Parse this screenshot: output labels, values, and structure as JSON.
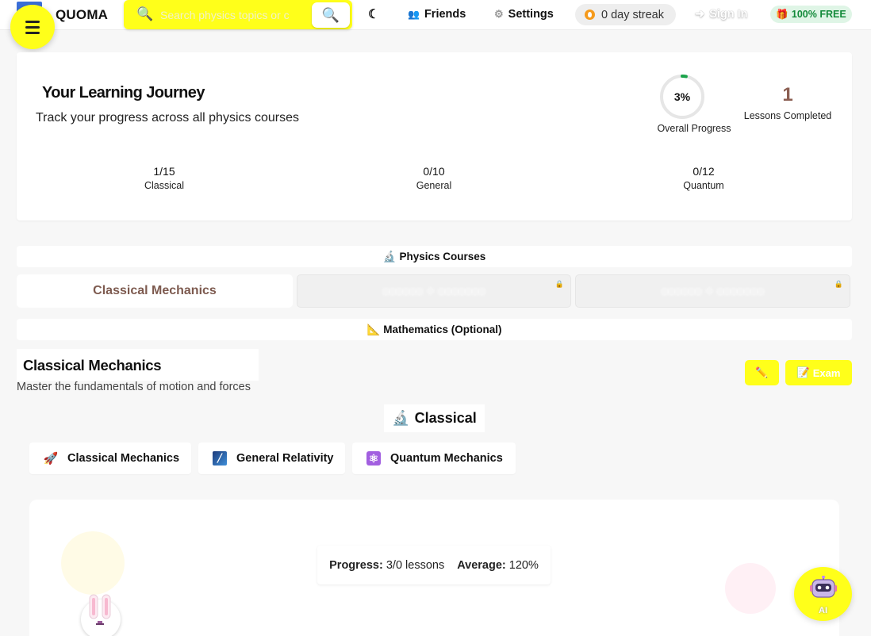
{
  "app": {
    "brand": "QUOMA",
    "colors": {
      "accent_yellow": "#ffff1a",
      "brand_brown": "#8b5e52",
      "free_green": "#138a3a"
    }
  },
  "topbar": {
    "search_placeholder": "Search physics topics or c",
    "friends_label": "Friends",
    "settings_label": "Settings",
    "streak_label": "0 day streak",
    "signin_label": "Sign In",
    "free_label": "100% FREE",
    "icons": [
      "menu-icon",
      "search-icon",
      "moon-icon",
      "friends-icon",
      "gear-icon",
      "fire-icon",
      "signin-icon",
      "gift-icon"
    ]
  },
  "journey": {
    "title": "Your Learning Journey",
    "subtitle": "Track your progress across all physics courses",
    "overall_progress_value": "3%",
    "overall_progress_fraction": 0.03,
    "overall_progress_label": "Overall Progress",
    "lessons_completed_value": "1",
    "lessons_completed_label": "Lessons Completed",
    "stats": [
      {
        "value": "1/15",
        "label": "Classical"
      },
      {
        "value": "0/10",
        "label": "General"
      },
      {
        "value": "0/12",
        "label": "Quantum"
      }
    ]
  },
  "sections": {
    "physics_courses": "Physics Courses",
    "mathematics": "Mathematics (Optional)"
  },
  "tabs": [
    {
      "label": "Classical Mechanics",
      "locked": false
    }
  ],
  "course": {
    "title": "Classical Mechanics",
    "subtitle": "Master the fundamentals of motion and forces",
    "exam_label": "Exam",
    "category_heading": "Classical",
    "subcourses": [
      {
        "label": "Classical Mechanics",
        "icon": "rocket-icon"
      },
      {
        "label": "General Relativity",
        "icon": "relativity-icon"
      },
      {
        "label": "Quantum Mechanics",
        "icon": "atom-icon"
      }
    ]
  },
  "path": {
    "progress_label": "Progress:",
    "progress_value": "3/0 lessons",
    "average_label": "Average:",
    "average_value": "120%"
  },
  "assistant": {
    "label": "AI"
  }
}
